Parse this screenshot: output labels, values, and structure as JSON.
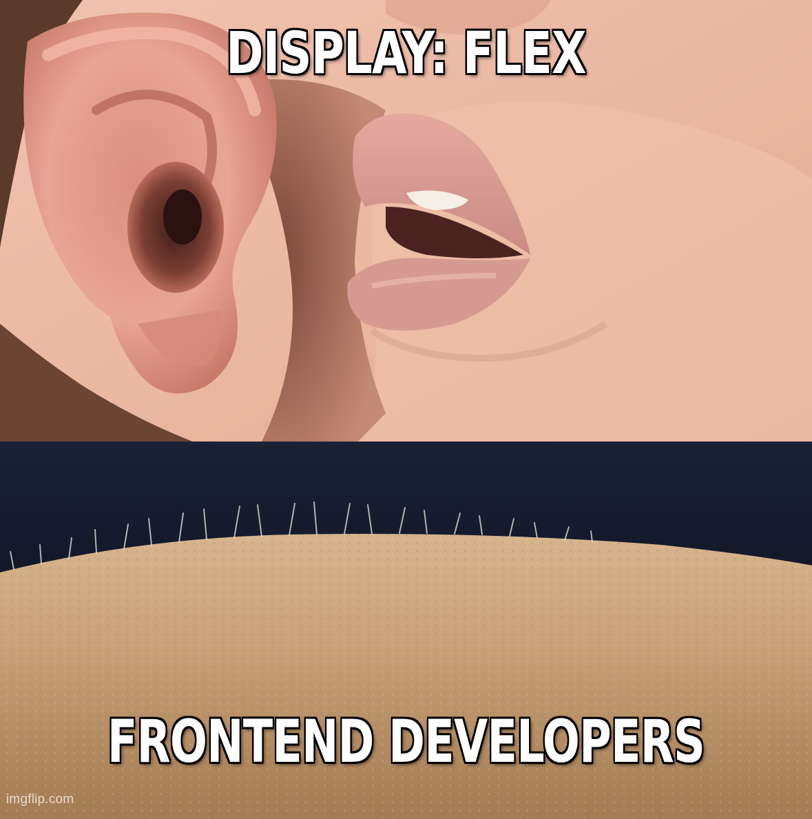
{
  "meme": {
    "top_caption": "DISPLAY: FLEX",
    "bottom_caption": "FRONTEND DEVELOPERS",
    "watermark": "imgflip.com"
  },
  "panels": [
    {
      "name": "whisper-panel",
      "depicts": "ear-and-lips-icon"
    },
    {
      "name": "goosebumps-panel",
      "depicts": "arm-skin-icon"
    }
  ],
  "colors": {
    "caption_fill": "#ffffff",
    "caption_outline": "#000000",
    "skin_light": "#e8b6a0",
    "skin_arm": "#c9a57e",
    "background_dark": "#0b0f1e"
  }
}
